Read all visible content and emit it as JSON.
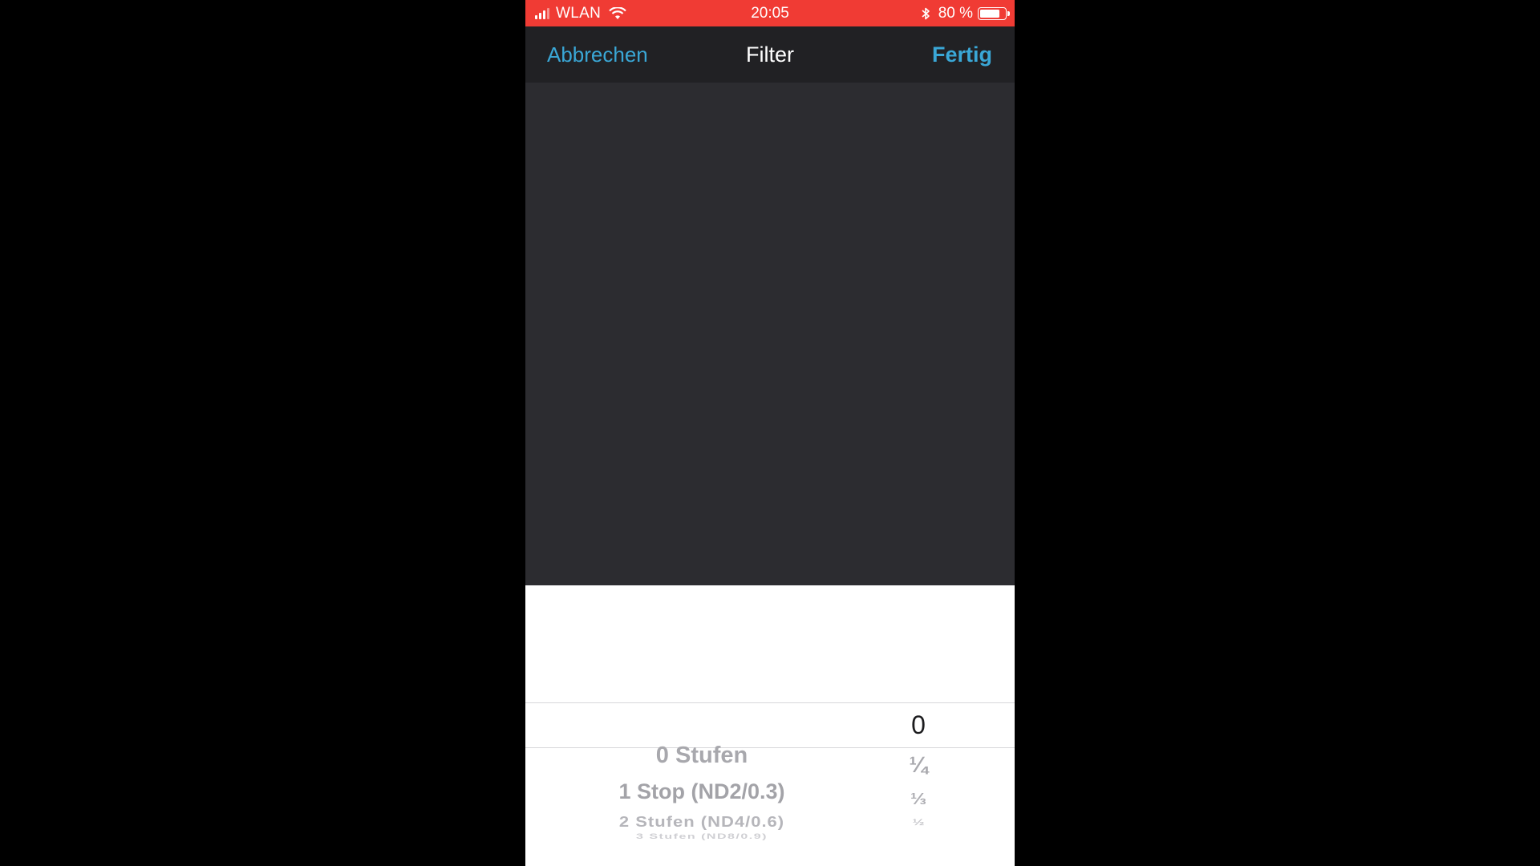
{
  "status_bar": {
    "carrier": "WLAN",
    "time": "20:05",
    "battery_percent_label": "80 %",
    "battery_level": 0.8,
    "signal_icon": "signal-bars-icon",
    "wifi_icon": "wifi-icon",
    "bluetooth_icon": "bluetooth-icon",
    "background_color": "#f03b34"
  },
  "nav_bar": {
    "cancel_label": "Abbrechen",
    "title": "Filter",
    "done_label": "Fertig",
    "accent_color": "#3aa7d6"
  },
  "picker": {
    "filter_options": [
      "0 Stufen",
      "1 Stop (ND2/0.3)",
      "2 Stufen (ND4/0.6)",
      "3 Stufen (ND8/0.9)"
    ],
    "fraction_options": [
      "0",
      "¼",
      "⅓",
      "½"
    ]
  }
}
